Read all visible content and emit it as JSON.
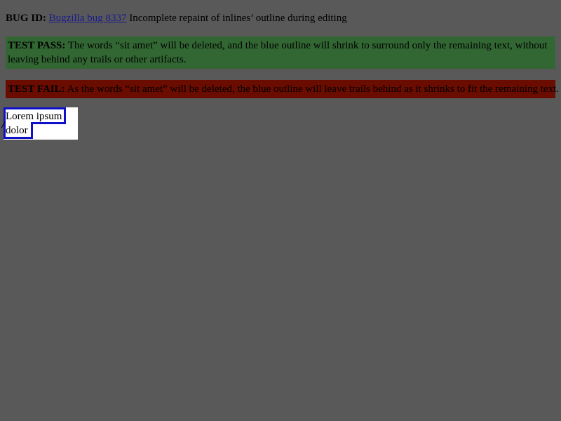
{
  "bug": {
    "label": "BUG ID:",
    "link_text": "Bugzilla bug 8337",
    "description": "Incomplete repaint of inlines’ outline during editing"
  },
  "pass": {
    "label": "TEST PASS:",
    "text": "The words “sit amet” will be deleted, and the blue outline will shrink to surround only the remaining text, without leaving behind any trails or other artifacts."
  },
  "fail": {
    "label": "TEST FAIL:",
    "text": "As the words “sit amet” will be deleted, the blue outline will leave trails behind as it shrinks to fit the remaining text."
  },
  "test_area": {
    "line1": "Lorem ipsum",
    "line2": "dolor"
  },
  "colors": {
    "background": "#595959",
    "pass_bg": "#326733",
    "fail_bg": "#6a0c00",
    "outline": "#1010c8",
    "link": "#1a1a8c"
  }
}
